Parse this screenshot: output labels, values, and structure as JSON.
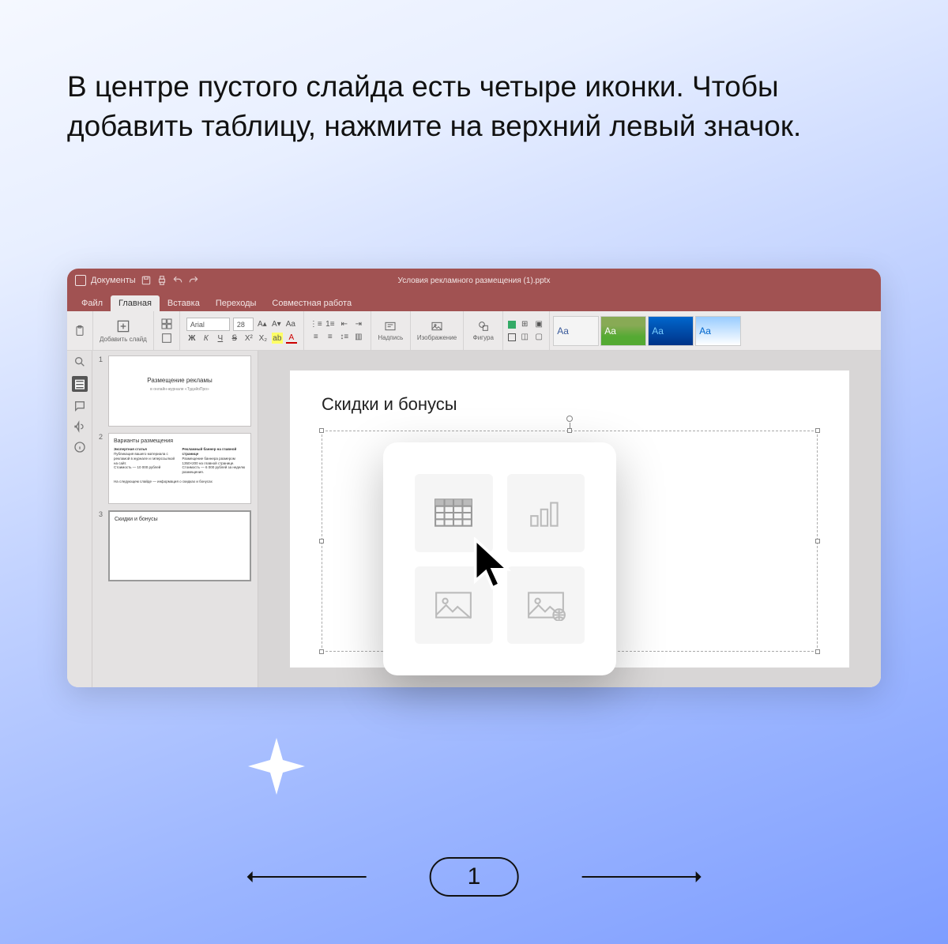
{
  "instruction_text": "В центре пустого слайда есть четыре иконки. Чтобы добавить таблицу, нажмите на верхний левый значок.",
  "app": {
    "name": "Документы",
    "document_title": "Условия рекламного размещения (1).pptx"
  },
  "menu": {
    "file": "Файл",
    "home": "Главная",
    "insert": "Вставка",
    "transitions": "Переходы",
    "collab": "Совместная работа"
  },
  "ribbon": {
    "add_slide": "Добавить слайд",
    "font_name": "Arial",
    "font_size": "28",
    "bold": "Ж",
    "italic": "К",
    "underline": "Ч",
    "strike": "Ꞩ",
    "textbox": "Надпись",
    "image": "Изображение",
    "shape": "Фигура",
    "theme_sample": "Aa"
  },
  "thumbnails": [
    {
      "n": "1",
      "title": "Размещение рекламы",
      "subtitle": "в онлайн-журнале «ТудэйоПро»"
    },
    {
      "n": "2",
      "title": "Варианты размещения",
      "col1_h": "Экспертная статья",
      "col1_b": "Публикация вашего материала с рекламой в журнале и гиперссылкой на сайт.",
      "col1_p": "Стоимость — 10 000 рублей",
      "col2_h": "Рекламный баннер на главной странице",
      "col2_b": "Размещение баннера размером 1350×200 на главной странице.",
      "col2_p": "Стоимость — 6 000 рублей за неделю размещения.",
      "footer": "На следующем слайде — информация о скидках и бонусах"
    },
    {
      "n": "3",
      "title": "Скидки и бонусы"
    }
  ],
  "slide": {
    "title": "Скидки и бонусы"
  },
  "popup_icons": {
    "table": "table-icon",
    "chart": "chart-icon",
    "image": "image-icon",
    "image_web": "image-web-icon"
  },
  "pager": {
    "number": "1"
  }
}
